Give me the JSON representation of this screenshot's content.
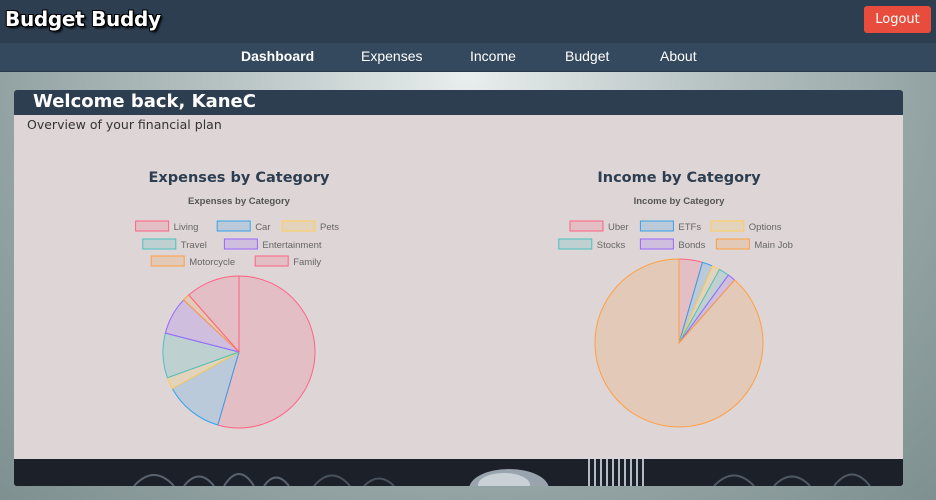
{
  "app": {
    "brand": "Budget Buddy"
  },
  "header": {
    "logout_label": "Logout"
  },
  "nav": {
    "items": [
      {
        "label": "Dashboard",
        "active": true
      },
      {
        "label": "Expenses",
        "active": false
      },
      {
        "label": "Income",
        "active": false
      },
      {
        "label": "Budget",
        "active": false
      },
      {
        "label": "About",
        "active": false
      }
    ]
  },
  "main": {
    "welcome": "Welcome back, KaneC",
    "subtitle": "Overview of your financial plan",
    "expenses_heading": "Expenses by Category",
    "income_heading": "Income by Category"
  },
  "chart_data": [
    {
      "type": "pie",
      "title": "Expenses by Category",
      "categories": [
        "Living",
        "Car",
        "Pets",
        "Travel",
        "Entertainment",
        "Motorcycle",
        "Family"
      ],
      "values": [
        54.5,
        12.5,
        2.5,
        9.5,
        8,
        1.5,
        11.5
      ],
      "colors": [
        "#ff6384",
        "#36a2eb",
        "#ffce56",
        "#4bc0c0",
        "#9966ff",
        "#ff9f40",
        "#ff6384"
      ],
      "legend": "top"
    },
    {
      "type": "pie",
      "title": "Income by Category",
      "categories": [
        "Uber",
        "ETFs",
        "Options",
        "Stocks",
        "Bonds",
        "Main Job"
      ],
      "values": [
        4.5,
        2,
        1.5,
        2,
        1.5,
        88.5
      ],
      "colors": [
        "#ff6384",
        "#36a2eb",
        "#ffce56",
        "#4bc0c0",
        "#9966ff",
        "#ff9f40"
      ],
      "legend": "top"
    }
  ]
}
